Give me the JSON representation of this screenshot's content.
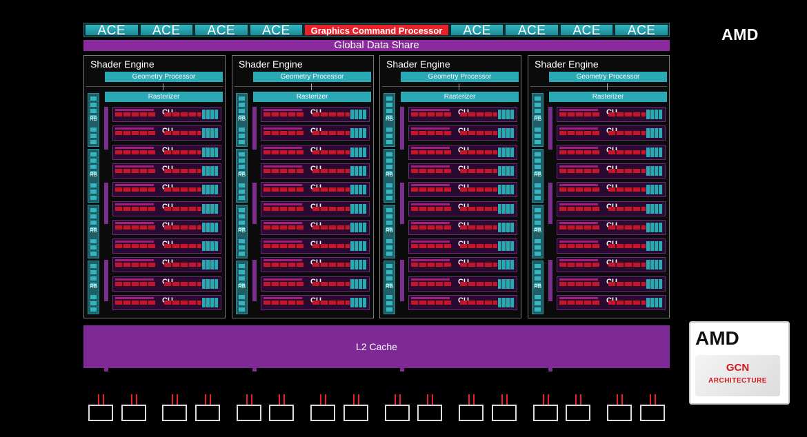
{
  "ace_bar": {
    "left_aces": [
      "ACE",
      "ACE",
      "ACE",
      "ACE"
    ],
    "command_processor": "Graphics Command Processor",
    "right_aces": [
      "ACE",
      "ACE",
      "ACE",
      "ACE"
    ]
  },
  "global_data_share": "Global Data Share",
  "shader_engines": [
    {
      "title": "Shader Engine",
      "geometry": "Geometry Processor",
      "rasterizer": "Rasterizer",
      "rb_label": "RB",
      "cu_label": "CU",
      "cu_count": 11,
      "rb_count": 4
    },
    {
      "title": "Shader Engine",
      "geometry": "Geometry Processor",
      "rasterizer": "Rasterizer",
      "rb_label": "RB",
      "cu_label": "CU",
      "cu_count": 11,
      "rb_count": 4
    },
    {
      "title": "Shader Engine",
      "geometry": "Geometry Processor",
      "rasterizer": "Rasterizer",
      "rb_label": "RB",
      "cu_label": "CU",
      "cu_count": 11,
      "rb_count": 4
    },
    {
      "title": "Shader Engine",
      "geometry": "Geometry Processor",
      "rasterizer": "Rasterizer",
      "rb_label": "RB",
      "cu_label": "CU",
      "cu_count": 11,
      "rb_count": 4
    }
  ],
  "l2_cache": "L2 Cache",
  "memory_controllers": 16,
  "brand": {
    "logo": "AMD",
    "badge_logo": "AMD",
    "badge_title": "GCN",
    "badge_subtitle": "ARCHITECTURE"
  },
  "colors": {
    "ace": "#2aa8b3",
    "command_processor": "#e8202a",
    "global_data_share": "#8a2a9c",
    "l2_cache": "#7e2a96"
  }
}
